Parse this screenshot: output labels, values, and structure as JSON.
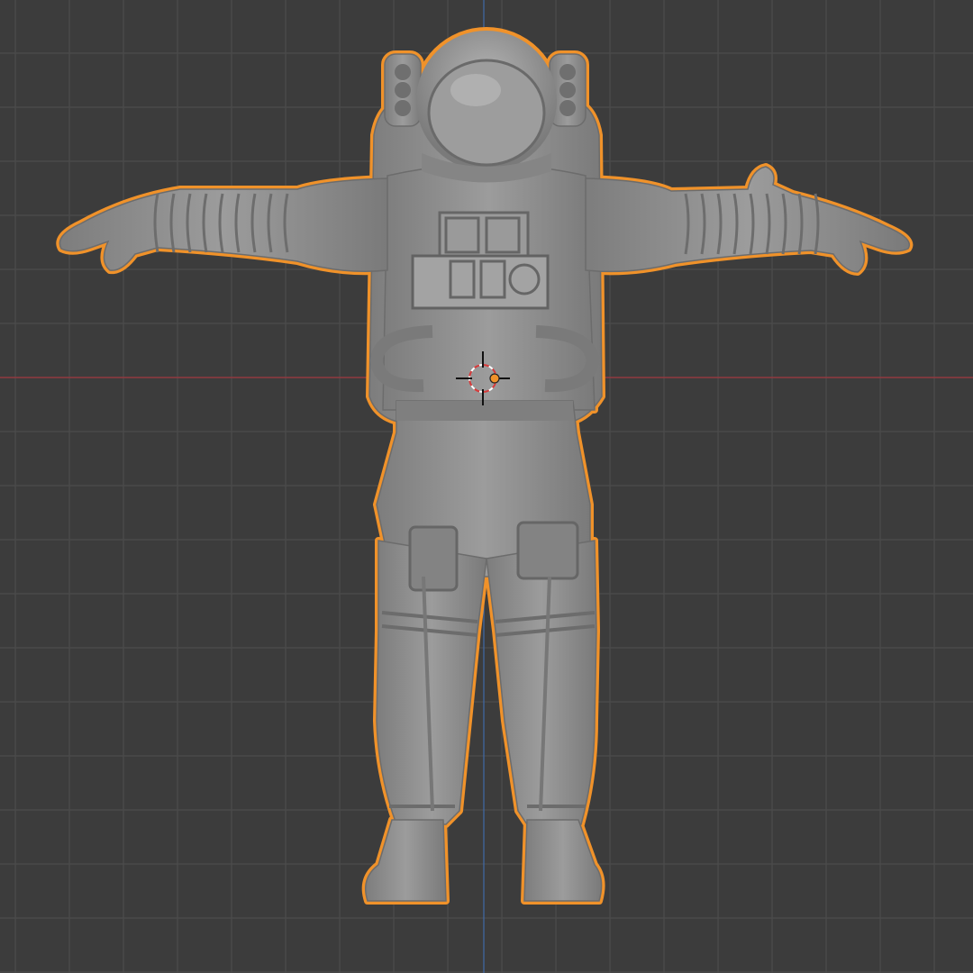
{
  "viewport": {
    "view": "front-orthographic",
    "grid_visible": true,
    "object": {
      "name": "",
      "icon": "astronaut-mesh-icon",
      "shading": "solid",
      "selected": true,
      "pose": "T-pose"
    },
    "axes": {
      "x_axis_color": "#a0363f",
      "z_axis_color": "#3f6aa8"
    },
    "colors": {
      "background": "#3c3c3c",
      "grid_line": "#4b4b4b",
      "mesh_fill": "#8f8f8f",
      "mesh_shadow": "#6c6c6c",
      "mesh_highlight": "#b1b1b1",
      "selection_outline": "#f0922a",
      "origin_dot": "#f0922a"
    },
    "cursor_3d": {
      "icon": "3d-cursor-icon"
    }
  }
}
